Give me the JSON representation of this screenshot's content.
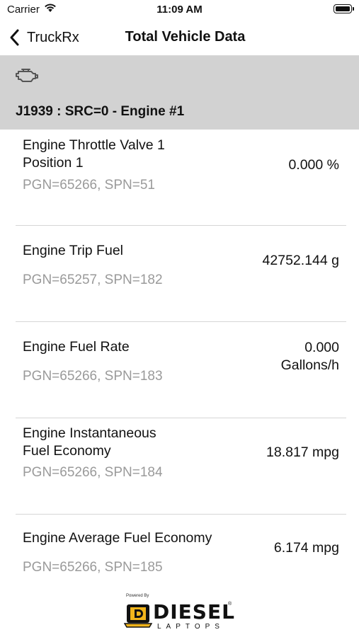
{
  "status_bar": {
    "carrier": "Carrier",
    "time": "11:09 AM"
  },
  "nav": {
    "back_label": "TruckRx",
    "title": "Total Vehicle Data"
  },
  "section": {
    "icon": "engine-icon",
    "title": "J1939 : SRC=0 - Engine #1"
  },
  "rows": [
    {
      "name": "Engine Throttle Valve 1 Position 1",
      "meta": "PGN=65266, SPN=51",
      "value": "0.000 %"
    },
    {
      "name": "Engine Trip Fuel",
      "meta": "PGN=65257, SPN=182",
      "value": "42752.144 g"
    },
    {
      "name": "Engine Fuel Rate",
      "meta": "PGN=65266, SPN=183",
      "value": "0.000 Gallons/h"
    },
    {
      "name": "Engine Instantaneous Fuel Economy",
      "meta": "PGN=65266, SPN=184",
      "value": "18.817 mpg"
    },
    {
      "name": "Engine Average Fuel Economy",
      "meta": "PGN=65266, SPN=185",
      "value": "6.174 mpg"
    }
  ],
  "footer": {
    "powered_by": "Powered By",
    "brand": "DIESEL",
    "brand_sub": "LAPTOPS",
    "accent_color": "#f2b51c"
  }
}
